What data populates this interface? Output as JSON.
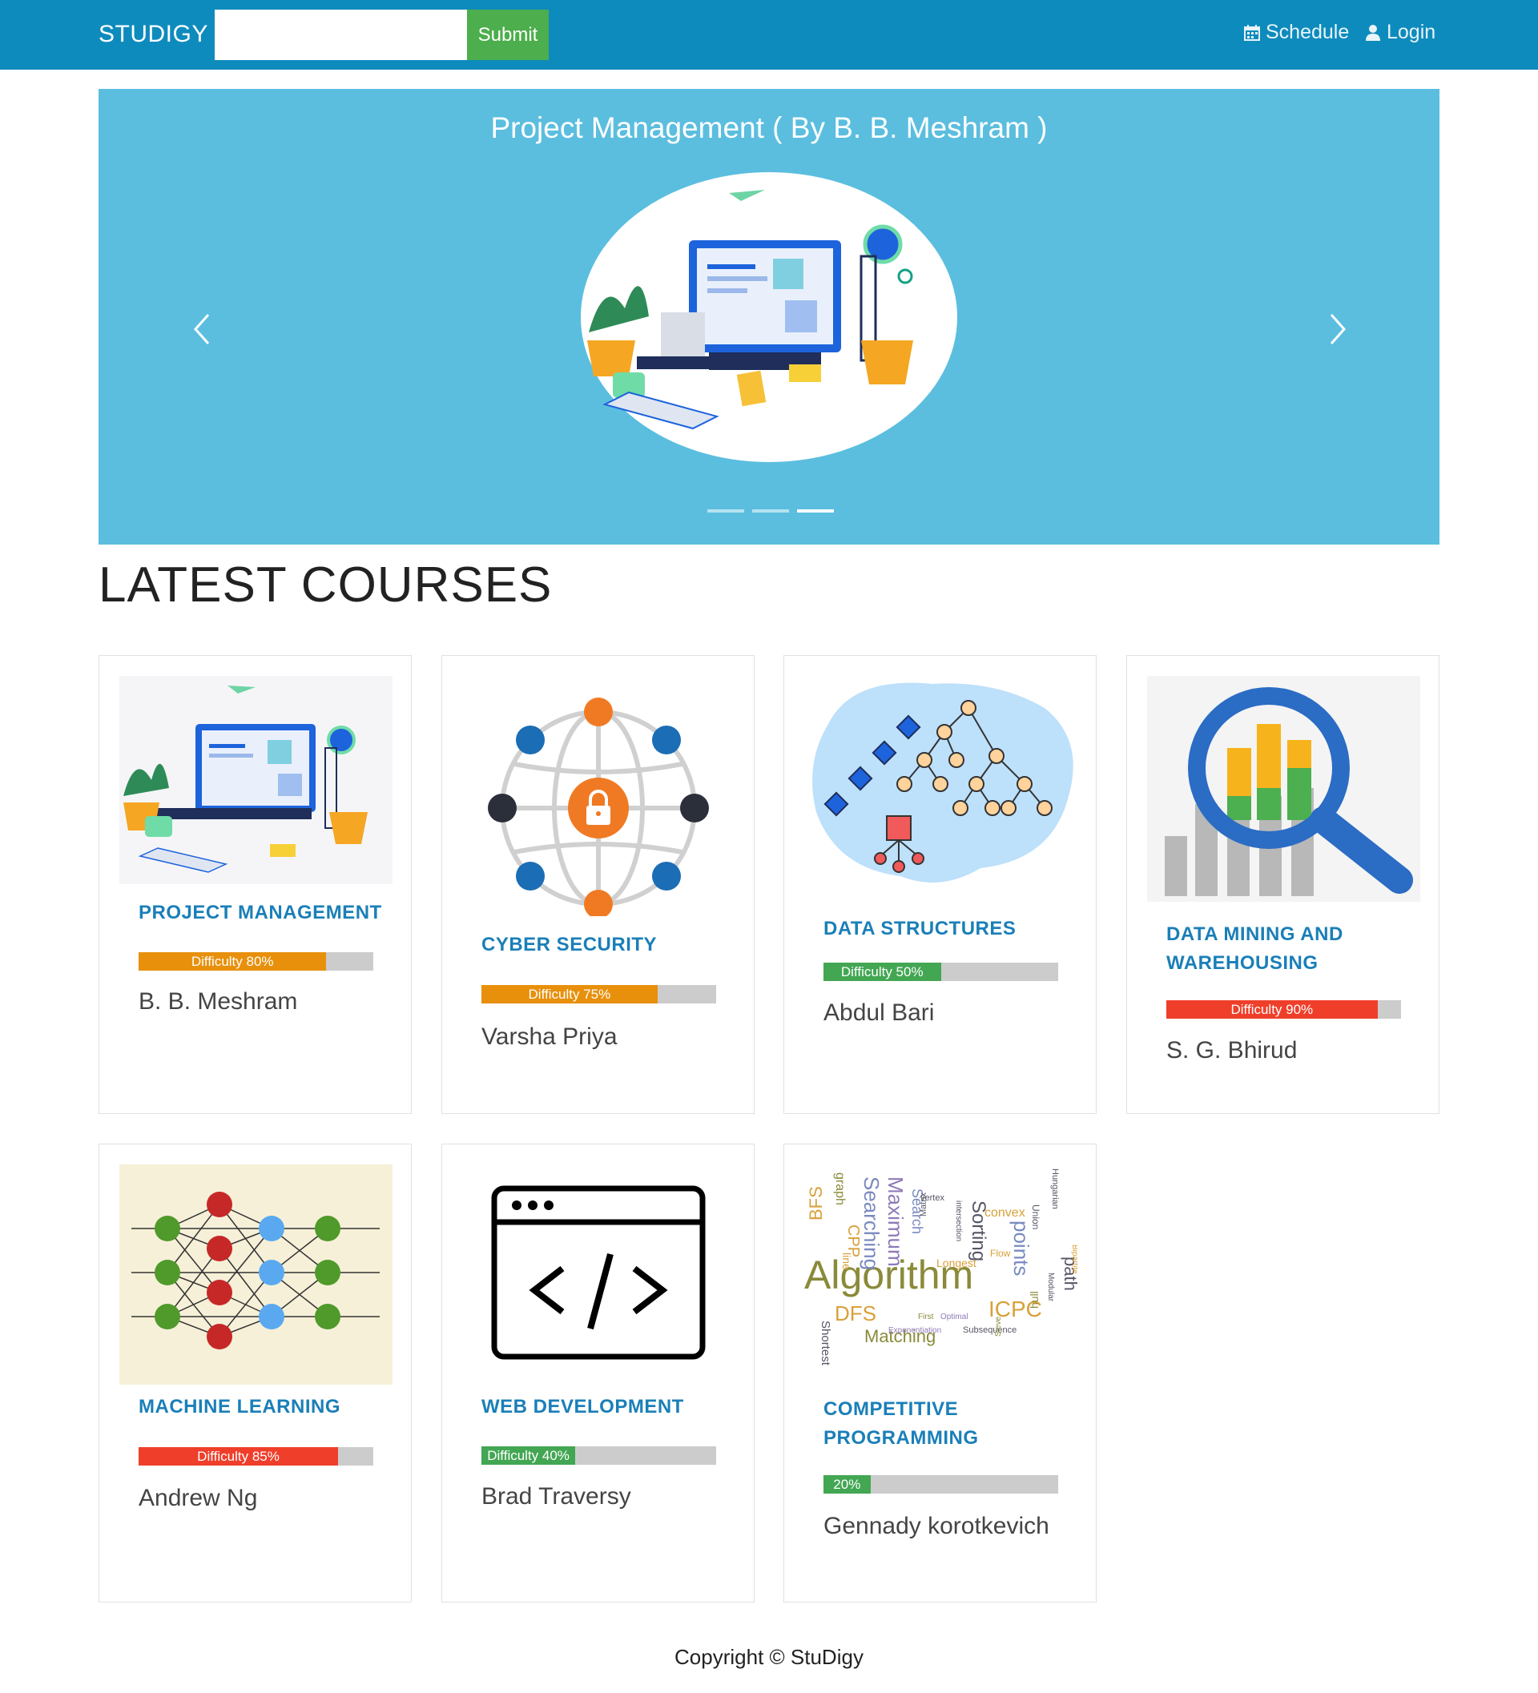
{
  "navbar": {
    "brand": "STUDIGY",
    "search": {
      "value": "",
      "placeholder": ""
    },
    "submit_label": "Submit",
    "schedule_label": "Schedule",
    "login_label": "Login"
  },
  "carousel": {
    "caption": "Project Management ( By B. B. Meshram )",
    "slides": 3,
    "active_slide": 3
  },
  "section_title": "LATEST COURSES",
  "courses": [
    {
      "title": "PROJECT MANAGEMENT",
      "difficulty_label": "Difficulty 80%",
      "difficulty": 80,
      "color": "#e8900c",
      "instructor": "B. B. Meshram"
    },
    {
      "title": "CYBER SECURITY",
      "difficulty_label": "Difficulty 75%",
      "difficulty": 75,
      "color": "#e8900c",
      "instructor": "Varsha Priya"
    },
    {
      "title": "DATA STRUCTURES",
      "difficulty_label": "Difficulty 50%",
      "difficulty": 50,
      "color": "#43a653",
      "instructor": "Abdul Bari"
    },
    {
      "title": "DATA MINING AND WAREHOUSING",
      "difficulty_label": "Difficulty 90%",
      "difficulty": 90,
      "color": "#ef3f2b",
      "instructor": "S. G. Bhirud"
    },
    {
      "title": "MACHINE LEARNING",
      "difficulty_label": "Difficulty 85%",
      "difficulty": 85,
      "color": "#ef3f2b",
      "instructor": "Andrew Ng"
    },
    {
      "title": "WEB DEVELOPMENT",
      "difficulty_label": "Difficulty 40%",
      "difficulty": 40,
      "color": "#43a653",
      "instructor": "Brad Traversy"
    },
    {
      "title": "COMPETITIVE PROGRAMMING",
      "difficulty_label": "20%",
      "difficulty": 20,
      "color": "#43a653",
      "instructor": "Gennady korotkevich"
    }
  ],
  "wordcloud": [
    "Algorithm",
    "Searching",
    "Maximum",
    "Sorting",
    "points",
    "path",
    "ICPC",
    "DFS",
    "BFS",
    "Matching",
    "convex",
    "graph",
    "Shortest",
    "Search",
    "Subsequence",
    "Exponentiation",
    "Optimal",
    "First",
    "vertex",
    "hull",
    "Longest",
    "Hungarian",
    "Flow",
    "Matrix",
    "Sieve",
    "Bipartite",
    "CPP",
    "line",
    "intersection",
    "Modular",
    "Union"
  ],
  "footer": "Copyright © StuDigy"
}
